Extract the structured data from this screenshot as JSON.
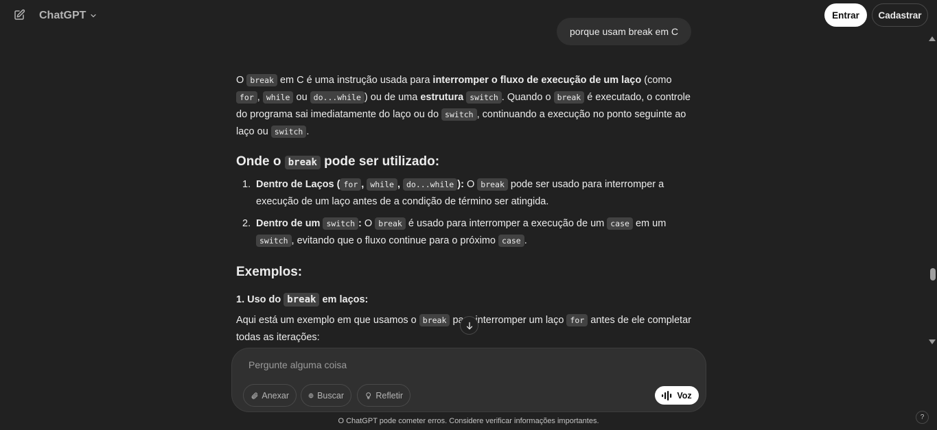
{
  "header": {
    "model_name": "ChatGPT",
    "login_label": "Entrar",
    "signup_label": "Cadastrar"
  },
  "user_message": "porque usam break em C",
  "answer": {
    "intro": {
      "t1": "O",
      "c1": "break",
      "t2": "em C é uma instrução usada para",
      "b1": "interromper o fluxo de execução de um laço",
      "t3": "(como",
      "c2": "for",
      "t4": ",",
      "c3": "while",
      "t5": "ou",
      "c4": "do...while",
      "t6": ") ou de uma",
      "b2": "estrutura",
      "c5": "switch",
      "t7": ". Quando o",
      "c6": "break",
      "t8": "é executado, o controle do programa sai imediatamente do laço ou do",
      "c7": "switch",
      "t9": ", continuando a execução no ponto seguinte ao laço ou",
      "c8": "switch",
      "t10": "."
    },
    "heading_onde": {
      "pre": "Onde o",
      "code": "break",
      "post": "pode ser utilizado:"
    },
    "list": [
      {
        "num": "1.",
        "bold_pre": "Dentro de Laços (",
        "c1": "for",
        "sep1": ",",
        "c2": "while",
        "sep2": ",",
        "c3": "do...while",
        "bold_post": "):",
        "t1": "O",
        "c4": "break",
        "t2": "pode ser usado para interromper a execução de um laço antes de a condição de término ser atingida."
      },
      {
        "num": "2.",
        "bold_pre": "Dentro de um",
        "c1": "switch",
        "bold_post": ":",
        "t1": "O",
        "c2": "break",
        "t2": "é usado para interromper a execução de um",
        "c3": "case",
        "t3": "em um",
        "c4": "switch",
        "t4": ", evitando que o fluxo continue para o próximo",
        "c5": "case",
        "t5": "."
      }
    ],
    "heading_exemplos": "Exemplos:",
    "sub_uso": {
      "pre": "1. Uso do",
      "code": "break",
      "post": "em laços:"
    },
    "para_aqui": {
      "t1": "Aqui está um exemplo em que usamos o",
      "c1": "break",
      "t2": "para interromper um laço",
      "c2": "for",
      "t3": "antes de ele completar todas as iterações:"
    }
  },
  "composer": {
    "placeholder": "Pergunte alguma coisa",
    "attach_label": "Anexar",
    "search_label": "Buscar",
    "reason_label": "Refletir",
    "voice_label": "Voz"
  },
  "footer_note": "O ChatGPT pode cometer erros. Considere verificar informações importantes.",
  "help_label": "?"
}
